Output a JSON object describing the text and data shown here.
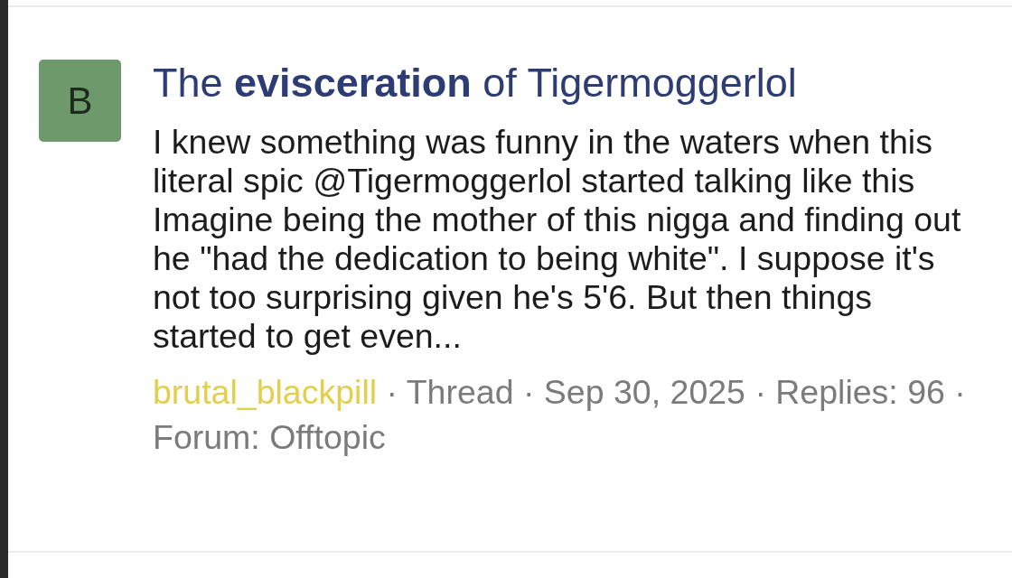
{
  "result": {
    "avatar": {
      "letter": "B"
    },
    "title": "The **evisceration** of Tigermoggerlol",
    "snippet": "I knew something was funny in the waters when this literal spic @Tigermoggerlol started talking like this Imagine being the mother of this nigga and finding out he \"had the dedication to being white\". I suppose it's not too surprising given he's 5'6. But then things started to get even...",
    "meta": {
      "author": "brutal_blackpill",
      "details": "· Thread · Sep 30, 2025 · Replies: 96 · Forum: Offtopic"
    }
  }
}
